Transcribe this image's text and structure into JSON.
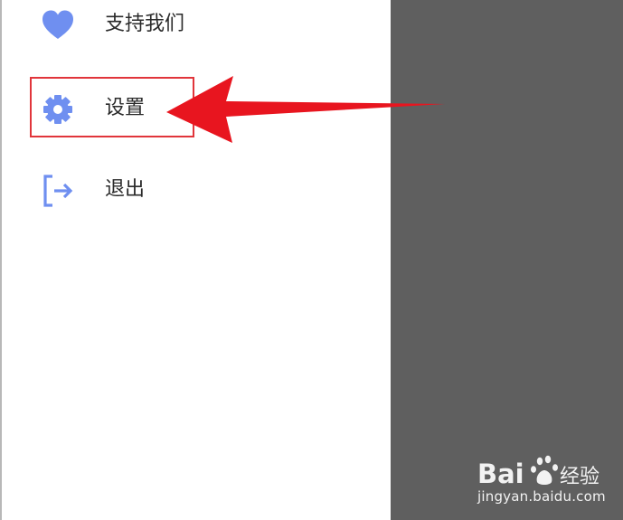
{
  "menu": {
    "items": [
      {
        "label": "支持我们",
        "icon": "heart-icon"
      },
      {
        "label": "设置",
        "icon": "gear-icon"
      },
      {
        "label": "退出",
        "icon": "logout-icon"
      }
    ]
  },
  "annotation": {
    "highlight_color": "#e1353b",
    "arrow_color": "#e8151f"
  },
  "watermark": {
    "brand": "Bai 经验",
    "url": "jingyan.baidu.com"
  },
  "colors": {
    "icon_accent": "#6f8ff0",
    "overlay": "#5f5f5f",
    "drawer_bg": "#ffffff"
  }
}
